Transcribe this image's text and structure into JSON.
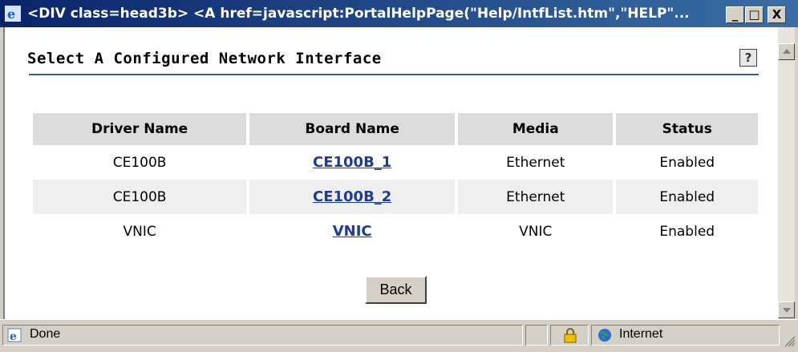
{
  "window": {
    "title": "<DIV class=head3b> <A href=javascript:PortalHelpPage(\"Help/IntfList.htm\",\"HELP\"...",
    "minimize_label": "_",
    "maximize_label": "□",
    "close_label": "X"
  },
  "page": {
    "title": "Select A Configured Network Interface",
    "help_label": "?"
  },
  "table": {
    "headers": [
      "Driver Name",
      "Board Name",
      "Media",
      "Status"
    ],
    "rows": [
      {
        "driver": "CE100B",
        "board": "CE100B_1",
        "media": "Ethernet",
        "status": "Enabled"
      },
      {
        "driver": "CE100B",
        "board": "CE100B_2",
        "media": "Ethernet",
        "status": "Enabled"
      },
      {
        "driver": "VNIC",
        "board": "VNIC",
        "media": "VNIC",
        "status": "Enabled"
      }
    ]
  },
  "back_button": "Back",
  "statusbar": {
    "status": "Done",
    "zone": "Internet"
  },
  "colors": {
    "title_bar": "#0a246a",
    "link": "#1f3c93",
    "title_rule": "#2e5f84",
    "header_bg": "#dcdcdc",
    "alt_row_bg": "#efefef"
  }
}
